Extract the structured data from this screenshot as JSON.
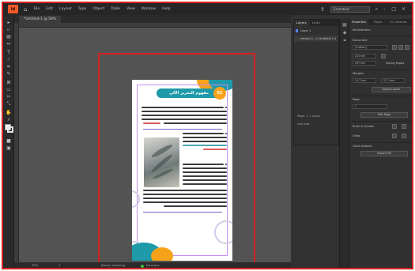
{
  "app": {
    "logo_text": "Id",
    "menu": [
      "File",
      "Edit",
      "Layout",
      "Type",
      "Object",
      "Table",
      "View",
      "Window",
      "Help"
    ],
    "workspace": "Essentials",
    "document_tab": "*Untitled-1 @ 59%"
  },
  "layers_panel": {
    "tabs": [
      "Layers",
      "Links"
    ],
    "layer_name": "Layer 1",
    "item_name": "<imsixi-1...> Untitled-1-0",
    "footer": "Page: 1, 1 Layer",
    "info_label": "Link Info"
  },
  "properties_panel": {
    "tabs": [
      "Properties",
      "Pages",
      "CC Libraries"
    ],
    "no_selection": "No Selection",
    "document_label": "Document",
    "preset": "[Custom]",
    "width_value": "210 mm",
    "height_value": "297 mm",
    "facing_pages": "Facing Pages",
    "margins_label": "Margins",
    "margin_value_1": "12.7 mm",
    "margin_value_2": "12.7 mm",
    "adjust_layout": "Adjust Layout",
    "page_label": "Page",
    "page_value": "1",
    "edit_page": "Edit Page",
    "ruler_guides": "Ruler & Guides",
    "grids": "Grids",
    "quick_actions": "Quick Actions",
    "import_file": "Import File"
  },
  "page_content": {
    "title": "مفهوم التحرير الآلي",
    "section_number": "01"
  },
  "statusbar": {
    "zoom": "59%",
    "page": "1",
    "profile": "[Basic] (working)",
    "errors": "No errors"
  },
  "colors": {
    "accent_red": "#d42121",
    "teal": "#1f9aa8",
    "orange": "#f7a21b",
    "purple": "#7c5cd1"
  }
}
